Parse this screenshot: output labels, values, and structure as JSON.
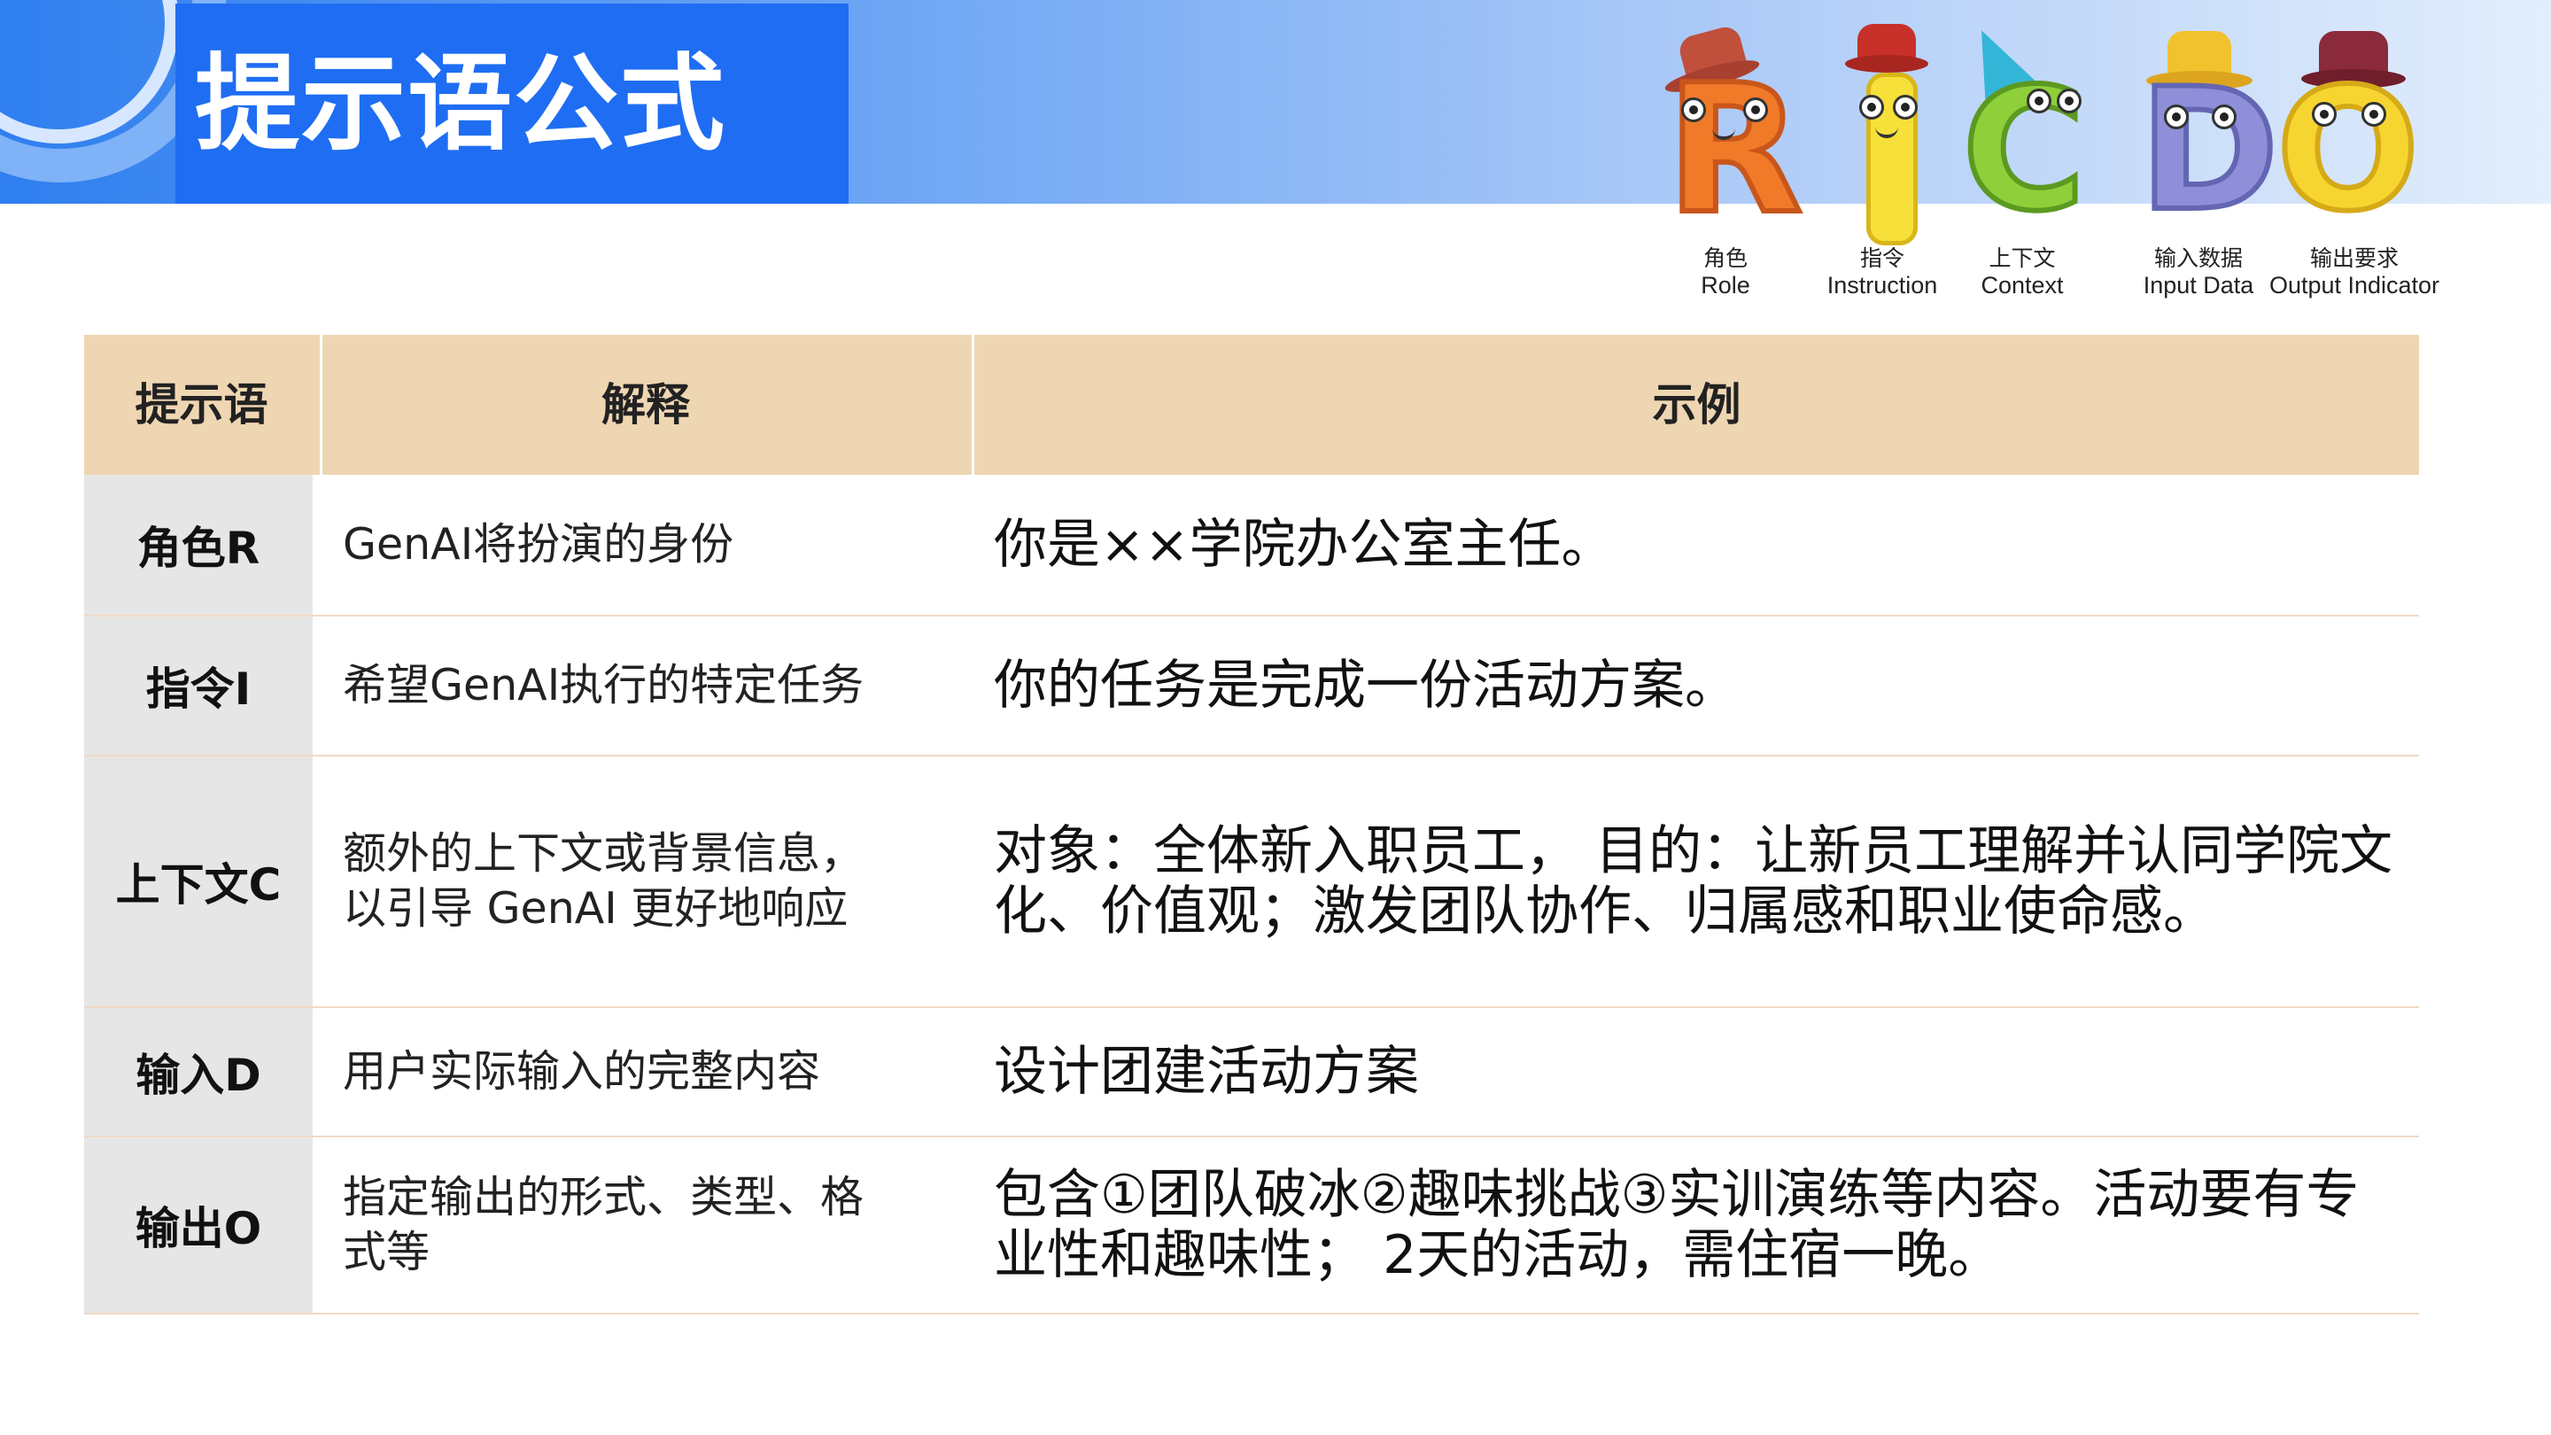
{
  "slide": {
    "title": "提示语公式"
  },
  "legend": {
    "letters": [
      "R",
      "I",
      "C",
      "D",
      "O"
    ],
    "items": [
      {
        "cn": "角色",
        "en": "Role"
      },
      {
        "cn": "指令",
        "en": "Instruction"
      },
      {
        "cn": "上下文",
        "en": "Context"
      },
      {
        "cn": "输入数据",
        "en": "Input Data"
      },
      {
        "cn": "输出要求",
        "en": "Output Indicator"
      }
    ]
  },
  "table": {
    "headers": [
      "提示语",
      "解释",
      "示例"
    ],
    "rows": [
      {
        "key": "角色R",
        "explanation": "GenAI将扮演的身份",
        "example": "你是××学院办公室主任。"
      },
      {
        "key": "指令I",
        "explanation": "希望GenAI执行的特定任务",
        "example": "你的任务是完成一份活动方案。"
      },
      {
        "key": "上下文C",
        "explanation": "额外的上下文或背景信息，\n以引导 GenAI 更好地响应",
        "example": "对象：全体新入职员工， 目的：让新员工理解并认同学院文\n化、价值观；激发团队协作、归属感和职业使命感。"
      },
      {
        "key": "输入D",
        "explanation": "用户实际输入的完整内容",
        "example": "设计团建活动方案"
      },
      {
        "key": "输出O",
        "explanation": "指定输出的形式、类型、格\n式等",
        "example": "包含①团队破冰②趣味挑战③实训演练等内容。活动要有专\n业性和趣味性； 2天的活动，需住宿一晚。"
      }
    ]
  },
  "colors": {
    "title_box": "#1f6df2",
    "table_header": "#efd6b2",
    "key_column": "#e6e6e6",
    "row_divider": "#f2d9c4"
  }
}
